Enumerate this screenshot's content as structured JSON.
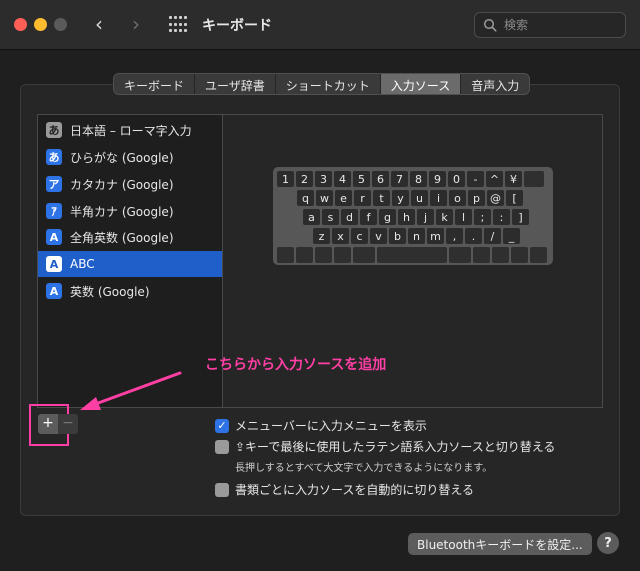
{
  "window": {
    "title": "キーボード"
  },
  "search": {
    "placeholder": "検索"
  },
  "tabs": [
    {
      "label": "キーボード",
      "active": false
    },
    {
      "label": "ユーザ辞書",
      "active": false
    },
    {
      "label": "ショートカット",
      "active": false
    },
    {
      "label": "入力ソース",
      "active": true
    },
    {
      "label": "音声入力",
      "active": false
    }
  ],
  "sources": [
    {
      "label": "日本語 – ローマ字入力",
      "icon": "あ",
      "icon_style": "gray",
      "selected": false
    },
    {
      "label": "ひらがな (Google)",
      "icon": "あ",
      "icon_style": "blue",
      "selected": false
    },
    {
      "label": "カタカナ (Google)",
      "icon": "ア",
      "icon_style": "blue",
      "selected": false
    },
    {
      "label": "半角カナ (Google)",
      "icon": "ｱ",
      "icon_style": "blue",
      "selected": false
    },
    {
      "label": "全角英数 (Google)",
      "icon": "A",
      "icon_style": "blue",
      "selected": false
    },
    {
      "label": "ABC",
      "icon": "A",
      "icon_style": "blue",
      "selected": true
    },
    {
      "label": "英数 (Google)",
      "icon": "A",
      "icon_style": "blue",
      "selected": false
    }
  ],
  "keyboard": {
    "row1": [
      "1",
      "2",
      "3",
      "4",
      "5",
      "6",
      "7",
      "8",
      "9",
      "0",
      "-",
      "^",
      "¥"
    ],
    "row2": [
      "q",
      "w",
      "e",
      "r",
      "t",
      "y",
      "u",
      "i",
      "o",
      "p",
      "@",
      "["
    ],
    "row3": [
      "a",
      "s",
      "d",
      "f",
      "g",
      "h",
      "j",
      "k",
      "l",
      ";",
      ":",
      "]"
    ],
    "row4": [
      "z",
      "x",
      "c",
      "v",
      "b",
      "n",
      "m",
      ",",
      ".",
      "/",
      "_"
    ]
  },
  "annotation": {
    "text": "こちらから入力ソースを追加"
  },
  "buttons": {
    "plus": "+",
    "minus": "−"
  },
  "options": {
    "menubar": {
      "label": "メニューバーに入力メニューを表示",
      "checked": true
    },
    "caps": {
      "label": "⇪キーで最後に使用したラテン語系入力ソースと切り替える",
      "checked": false,
      "note": "長押しするとすべて大文字で入力できるようになります。"
    },
    "perdoc": {
      "label": "書類ごとに入力ソースを自動的に切り替える",
      "checked": false
    }
  },
  "footer": {
    "bluetooth_button": "Bluetoothキーボードを設定...",
    "help": "?"
  },
  "colors": {
    "accent": "#2d73e6",
    "selection": "#1f5fc9",
    "annotation": "#ff3fa4"
  }
}
